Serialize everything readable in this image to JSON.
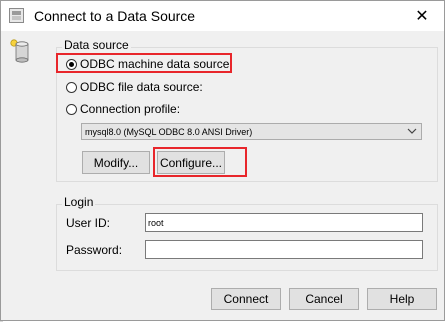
{
  "window": {
    "title": "Connect to a Data Source",
    "close_glyph": "✕"
  },
  "data_source": {
    "legend": "Data source",
    "options": [
      {
        "label": "ODBC machine data source:",
        "selected": true
      },
      {
        "label": "ODBC file data source:",
        "selected": false
      },
      {
        "label": "Connection profile:",
        "selected": false
      }
    ],
    "selected_driver": "mysql8.0 (MySQL ODBC 8.0 ANSI Driver)",
    "modify_label": "Modify...",
    "configure_label": "Configure..."
  },
  "login": {
    "legend": "Login",
    "user_id_label": "User ID:",
    "user_id_value": "root",
    "password_label": "Password:",
    "password_value": ""
  },
  "footer": {
    "connect_label": "Connect",
    "cancel_label": "Cancel",
    "help_label": "Help"
  },
  "colors": {
    "highlight": "#e8262b",
    "dialog_bg": "#f0f0f0",
    "button_bg": "#e1e1e1"
  },
  "icons": {
    "title": "app-icon",
    "data_source": "database-icon",
    "dropdown": "chevron-down-icon"
  }
}
